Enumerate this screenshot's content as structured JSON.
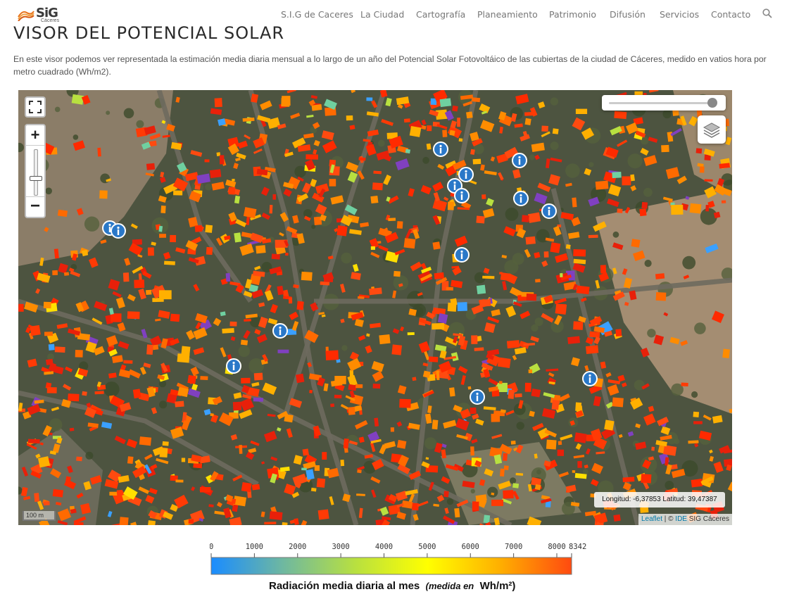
{
  "logo": {
    "text": "SiG",
    "subtext": "Cáceres"
  },
  "nav": {
    "items": [
      "S.I.G de Caceres",
      "La Ciudad",
      "Cartografía",
      "Planeamiento",
      "Patrimonio",
      "Difusión",
      "Servicios",
      "Contacto"
    ]
  },
  "page": {
    "title": "VISOR DEL POTENCIAL SOLAR",
    "intro": "En este visor podemos ver representada la estimación media diaria mensual a lo largo de un año del Potencial Solar Fotovoltáico de las cubiertas de la ciudad de Cáceres, medido en vatios hora por metro cuadrado (Wh/m2)."
  },
  "map": {
    "zoom_in": "+",
    "zoom_out": "−",
    "coordinates": "Longitud: -6,37853 Latitud: 39,47387",
    "scale": "100 m",
    "attribution": {
      "leaflet": "Leaflet",
      "separator": " | © ",
      "ide": "IDE",
      "owner": " SIG Cáceres"
    },
    "opacity_fraction": 0.92
  },
  "legend": {
    "ticks": [
      "0",
      "1000",
      "2000",
      "3000",
      "4000",
      "5000",
      "6000",
      "7000",
      "8000",
      "8342"
    ],
    "min": 0,
    "max": 8342,
    "title_main": "Radiación media diaria al mes",
    "title_italic": "(medida en",
    "title_unit": "Wh/m²)",
    "colors": [
      "#1a8cff",
      "#6fb8a0",
      "#b8e040",
      "#ffff00",
      "#ffb000",
      "#ff4a10"
    ]
  }
}
